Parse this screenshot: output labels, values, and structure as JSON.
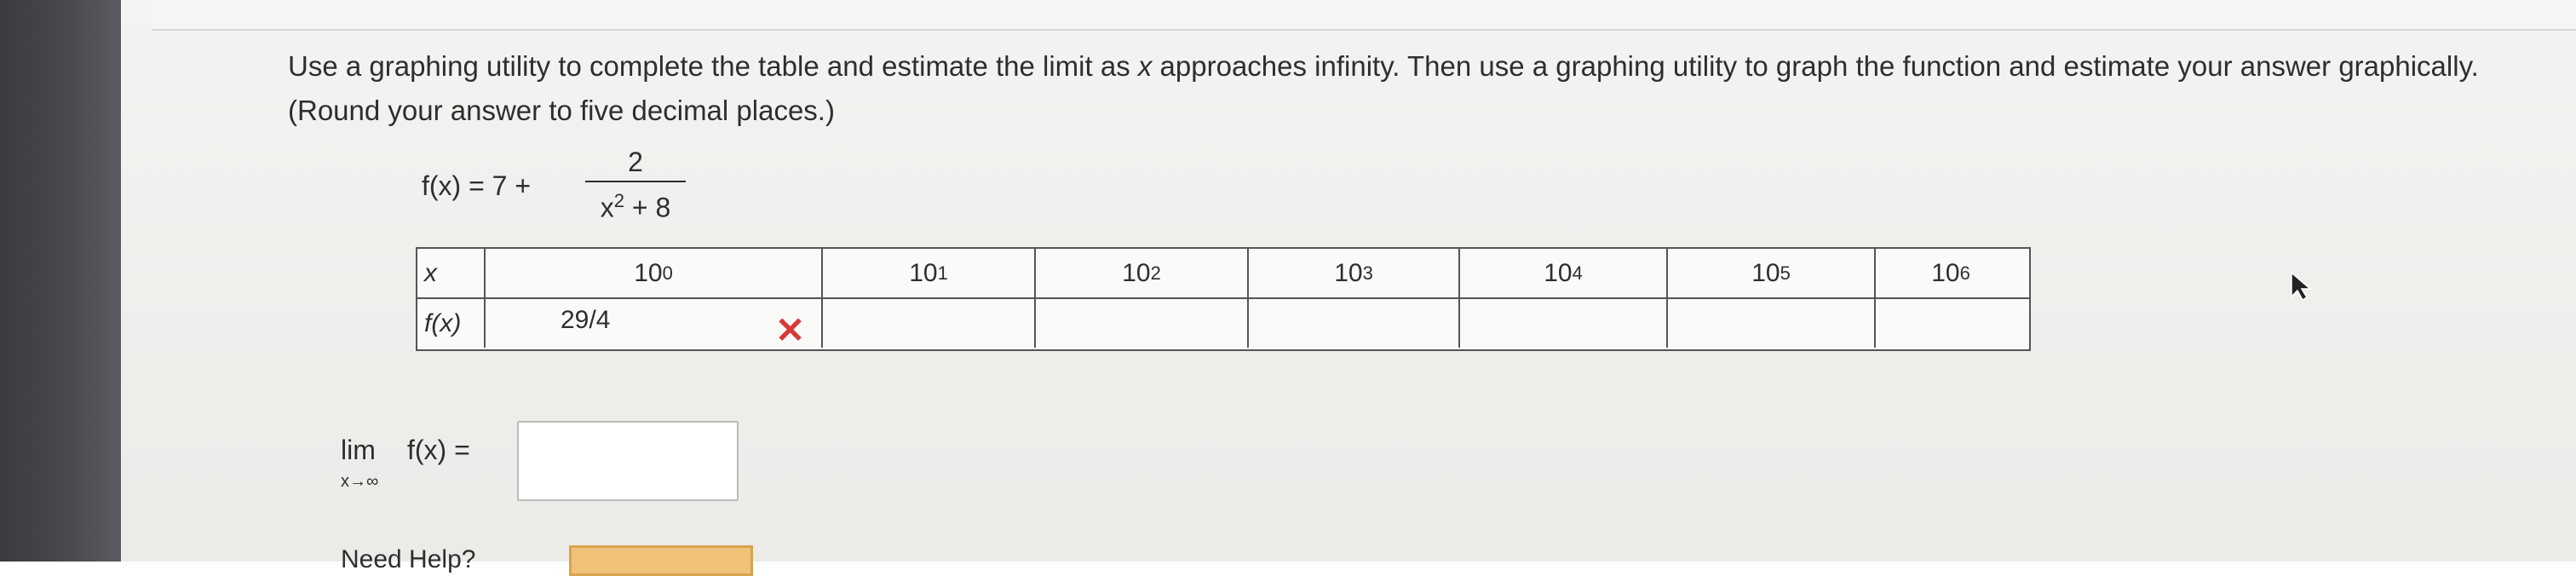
{
  "question": {
    "text_before_x": "Use a graphing utility to complete the table and estimate the limit as ",
    "var_x": "x",
    "text_after_x": " approaches infinity. Then use a graphing utility to graph the function and estimate your answer graphically. (Round your answer to five decimal places.)"
  },
  "formula": {
    "lhs": "f(x) = 7 +",
    "numerator": "2",
    "den_base": "x",
    "den_exp": "2",
    "den_rest": " + 8"
  },
  "table": {
    "header_label": "x",
    "row_label": "f(x)",
    "x_values": [
      {
        "base": "10",
        "exp": "0"
      },
      {
        "base": "10",
        "exp": "1"
      },
      {
        "base": "10",
        "exp": "2"
      },
      {
        "base": "10",
        "exp": "3"
      },
      {
        "base": "10",
        "exp": "4"
      },
      {
        "base": "10",
        "exp": "5"
      },
      {
        "base": "10",
        "exp": "6"
      }
    ],
    "first_value": "29/4",
    "first_status_icon": "incorrect-x-icon"
  },
  "limit": {
    "lim": "lim",
    "sub": "x→∞",
    "fx": "f(x) ="
  },
  "bottom": {
    "partial_text": "Need Help?"
  },
  "colors": {
    "incorrect": "#d43b3b",
    "button": "#f0c27a"
  }
}
